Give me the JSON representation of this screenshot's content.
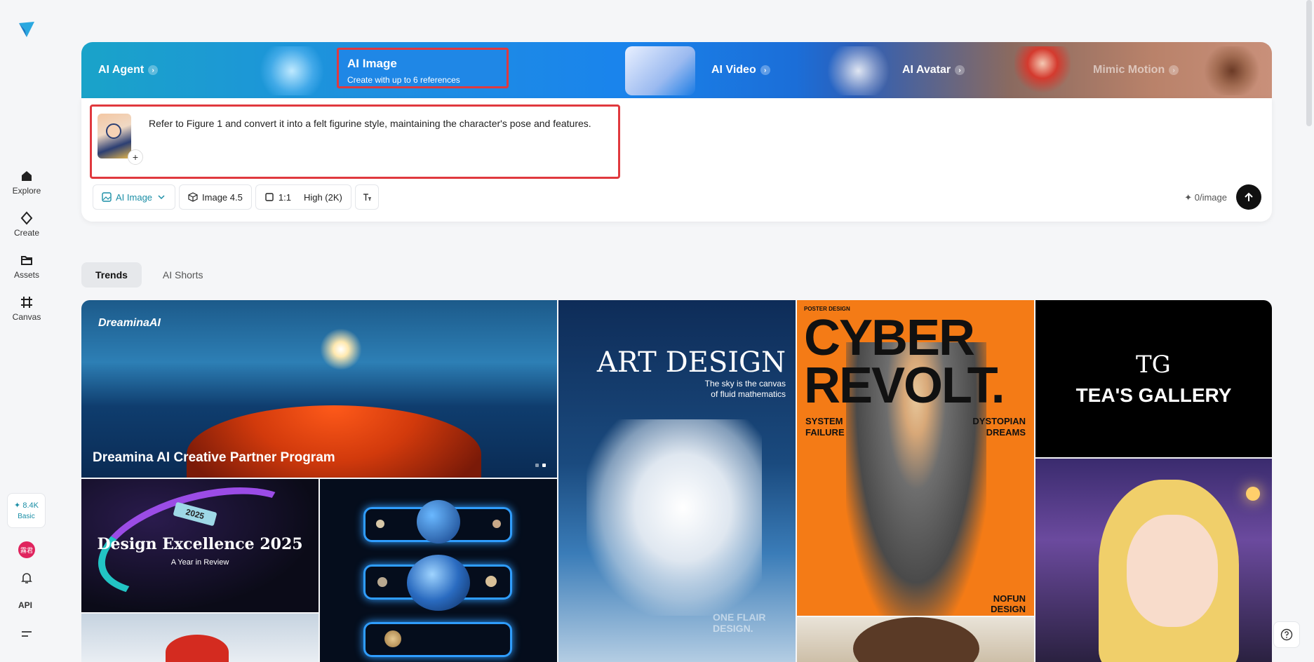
{
  "sidebar": {
    "logo": "dreamina-logo-icon",
    "items": [
      {
        "label": "Explore",
        "icon": "home-icon"
      },
      {
        "label": "Create",
        "icon": "sparkle-icon"
      },
      {
        "label": "Assets",
        "icon": "folder-icon"
      },
      {
        "label": "Canvas",
        "icon": "canvas-icon"
      }
    ],
    "credits": {
      "amount": "✦ 8.4K",
      "plan": "Basic"
    },
    "avatar_text": "霧君",
    "api_label": "API"
  },
  "banner": {
    "tabs": [
      {
        "label": "AI Agent"
      },
      {
        "label": "AI Image",
        "subtitle": "Create with up to 6 references"
      },
      {
        "label": "AI Video"
      },
      {
        "label": "AI Avatar"
      },
      {
        "label": "Mimic Motion"
      }
    ]
  },
  "prompt": {
    "text": "Refer to Figure 1 and convert it into a felt figurine style, maintaining the character's pose and features.",
    "add_ref": "+"
  },
  "toolbar": {
    "mode": "AI Image",
    "model": "Image 4.5",
    "ratio": "1:1",
    "quality": "High (2K)",
    "cost": "✦ 0/image"
  },
  "feed_tabs": [
    "Trends",
    "AI Shorts"
  ],
  "gallery": {
    "hero": {
      "brand": "DreaminaAI",
      "caption": "Dreamina AI Creative Partner Program"
    },
    "excellence": {
      "tag": "2025",
      "title": "Design Excellence 2025",
      "subtitle": "A Year in Review"
    },
    "art": {
      "title": "ART DESIGN",
      "subtitle_1": "The sky is the canvas",
      "subtitle_2": "of fluid mathematics",
      "mark_1": "ONE FLAIR",
      "mark_2": "DESIGN."
    },
    "cyber": {
      "tiny": "POSTER DESIGN",
      "big_1": "CYBER",
      "big_2": "REVOLT.",
      "left_1": "SYSTEM",
      "left_2": "FAILURE",
      "right_1": "DYSTOPIAN",
      "right_2": "DREAMS",
      "bottom_1": "NOFUN",
      "bottom_2": "DESIGN"
    },
    "tea": {
      "logo": "TG",
      "title": "TEA'S GALLERY"
    }
  }
}
